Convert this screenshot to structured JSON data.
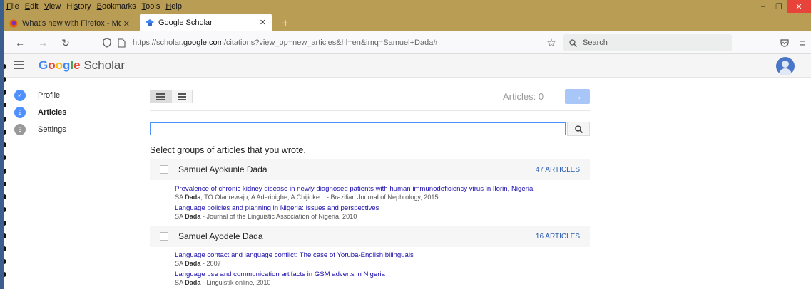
{
  "menu": [
    "File",
    "Edit",
    "View",
    "History",
    "Bookmarks",
    "Tools",
    "Help"
  ],
  "menu_underline": [
    "F",
    "E",
    "V",
    "s",
    "B",
    "T",
    "H"
  ],
  "tabs": [
    {
      "title": "What's new with Firefox - More",
      "close": "✕"
    },
    {
      "title": "Google Scholar",
      "close": "✕"
    }
  ],
  "newtab": "+",
  "url": {
    "prefix": "https://scholar.",
    "host": "google.com",
    "suffix": "/citations?view_op=new_articles&hl=en&imq=Samuel+Dada#"
  },
  "search_placeholder": "Search",
  "logo": {
    "g": "G",
    "o1": "o",
    "o2": "o",
    "g2": "g",
    "l": "l",
    "e": "e",
    "scholar": "Scholar"
  },
  "steps": [
    {
      "num": "✓",
      "label": "Profile"
    },
    {
      "num": "2",
      "label": "Articles"
    },
    {
      "num": "3",
      "label": "Settings"
    }
  ],
  "articles_count": "Articles: 0",
  "next_arrow": "→",
  "instruction": "Select groups of articles that you wrote.",
  "groups": [
    {
      "name": "Samuel Ayokunle Dada",
      "count": "47 ARTICLES",
      "articles": [
        {
          "title": "Prevalence of chronic kidney disease in newly diagnosed patients with human immunodeficiency virus in Ilorin, Nigeria",
          "authors_pre": "SA ",
          "authors_bold": "Dada",
          "authors_post": ", TO Olanrewaju, A Aderibigbe, A Chijioke... - Brazilian Journal of Nephrology, 2015"
        },
        {
          "title": "Language policies and planning in Nigeria: Issues and perspectives",
          "authors_pre": "SA ",
          "authors_bold": "Dada",
          "authors_post": " - Journal of the Linguistic Association of Nigeria, 2010"
        }
      ]
    },
    {
      "name": "Samuel Ayodele Dada",
      "count": "16 ARTICLES",
      "articles": [
        {
          "title": "Language contact and language conflict: The case of Yoruba-English bilinguals",
          "authors_pre": "SA ",
          "authors_bold": "Dada",
          "authors_post": " - 2007"
        },
        {
          "title": "Language use and communication artifacts in GSM adverts in Nigeria",
          "authors_pre": "SA ",
          "authors_bold": "Dada",
          "authors_post": " - Linguistik online, 2010"
        }
      ]
    }
  ],
  "colors": {
    "chrome": "#b99d55",
    "accent": "#4d90fe",
    "link": "#1a0dab",
    "close": "#e8433a"
  }
}
